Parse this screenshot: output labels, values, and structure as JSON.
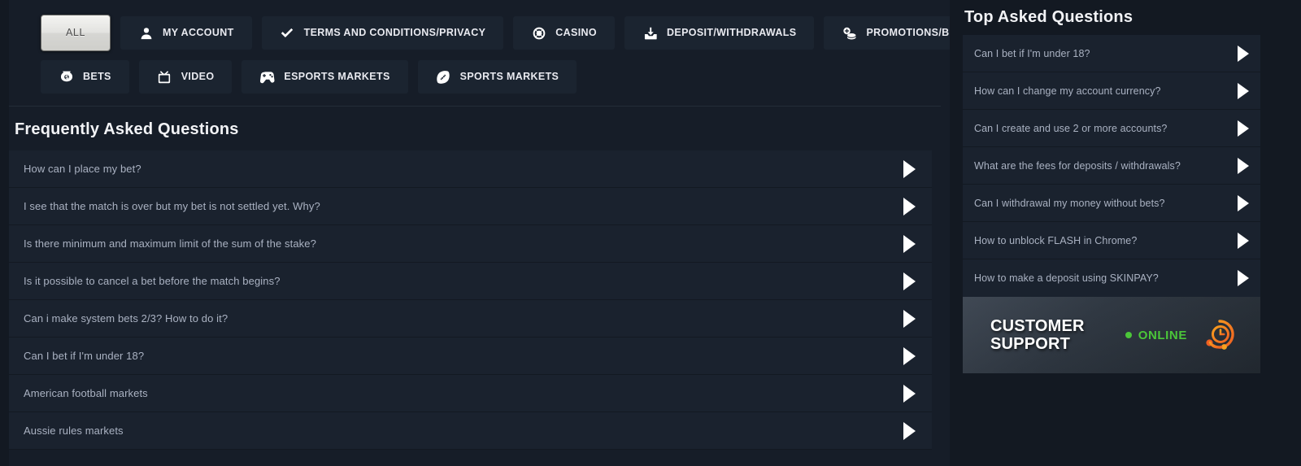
{
  "theme": {
    "page_bg": "#131922",
    "panel_bg": "#1a222e",
    "column_bg": "#161d28",
    "text_muted": "#aab2c2",
    "text_bright": "#f2f3f6",
    "accent_green": "#4bc639",
    "accent_orange": "#f07f22"
  },
  "tabs": {
    "row1": [
      {
        "label": "ALL",
        "icon": "none",
        "active": true
      },
      {
        "label": "MY ACCOUNT",
        "icon": "user-icon",
        "active": false
      },
      {
        "label": "TERMS AND CONDITIONS/PRIVACY",
        "icon": "check-icon",
        "active": false
      },
      {
        "label": "CASINO",
        "icon": "casino-chip-icon",
        "active": false
      },
      {
        "label": "DEPOSIT/WITHDRAWALS",
        "icon": "download-inbox-icon",
        "active": false
      },
      {
        "label": "PROMOTIONS/BONUSES",
        "icon": "coins-plus-icon",
        "active": false
      }
    ],
    "row2": [
      {
        "label": "BETS",
        "icon": "money-bag-icon",
        "active": false
      },
      {
        "label": "VIDEO",
        "icon": "tv-icon",
        "active": false
      },
      {
        "label": "ESPORTS MARKETS",
        "icon": "gamepad-icon",
        "active": false
      },
      {
        "label": "SPORTS MARKETS",
        "icon": "football-icon",
        "active": false
      }
    ]
  },
  "faq": {
    "title": "Frequently Asked Questions",
    "items": [
      "How can I place my bet?",
      "I see that the match is over but my bet is not settled yet. Why?",
      "Is there minimum and maximum limit of the sum of the stake?",
      "Is it possible to cancel a bet before the match begins?",
      "Can i make system bets 2/3? How to do it?",
      "Can I bet if I'm under 18?",
      "American football markets",
      "Aussie rules markets"
    ]
  },
  "sidebar": {
    "title": "Top Asked Questions",
    "items": [
      "Can I bet if I'm under 18?",
      "How can I change my account currency?",
      "Can I create and use 2 or more accounts?",
      "What are the fees for deposits / withdrawals?",
      "Can I withdrawal my money without bets?",
      "How to unblock FLASH in Chrome?",
      "How to make a deposit using SKINPAY?"
    ],
    "support": {
      "line1": "CUSTOMER",
      "line2": "SUPPORT",
      "status": "ONLINE",
      "icon": "headset-clock-icon"
    }
  }
}
